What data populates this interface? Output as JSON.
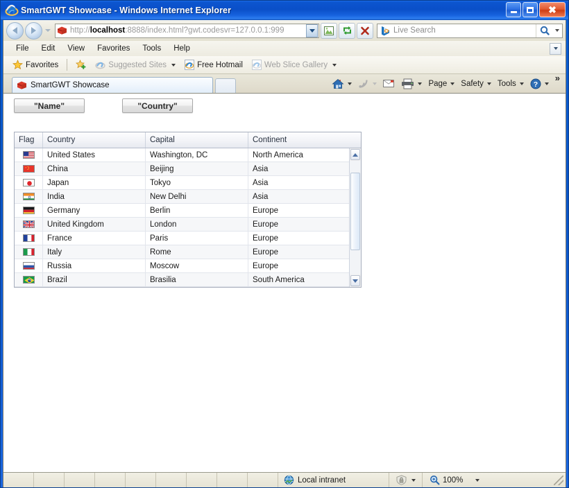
{
  "window": {
    "title": "SmartGWT Showcase - Windows Internet Explorer",
    "icon": "ie-logo-icon",
    "minimize_label": "Minimize",
    "maximize_label": "Maximize",
    "close_label": "Close"
  },
  "nav": {
    "back_label": "Back",
    "forward_label": "Forward",
    "recent_pages_label": "Recent Pages",
    "address_prefix": "http://",
    "address_host": "localhost",
    "address_rest": ":8888/index.html?gwt.codesvr=127.0.0.1:999",
    "address_full": "http://localhost:8888/index.html?gwt.codesvr=127.0.0.1:999",
    "compat_label": "Compatibility View",
    "refresh_label": "Refresh",
    "stop_label": "Stop"
  },
  "search": {
    "placeholder": "Live Search",
    "provider_icon": "bing-logo-icon",
    "go_label": "Search",
    "dropdown_label": "Search Options"
  },
  "menu": {
    "items": [
      {
        "label": "File"
      },
      {
        "label": "Edit"
      },
      {
        "label": "View"
      },
      {
        "label": "Favorites"
      },
      {
        "label": "Tools"
      },
      {
        "label": "Help"
      }
    ]
  },
  "favorites_bar": {
    "favorites_label": "Favorites",
    "add_label": "Add to Favorites Bar",
    "items": [
      {
        "label": "Suggested Sites",
        "dim": true,
        "caret": true
      },
      {
        "label": "Free Hotmail",
        "dim": false,
        "caret": false
      },
      {
        "label": "Web Slice Gallery",
        "dim": true,
        "caret": true
      }
    ]
  },
  "tabs": {
    "active": {
      "label": "SmartGWT Showcase",
      "icon": "page-icon"
    },
    "new_tab_label": "New Tab"
  },
  "command_bar": {
    "home_label": "Home",
    "feeds_label": "Feeds",
    "mail_label": "Read Mail",
    "print_label": "Print",
    "page_label": "Page",
    "safety_label": "Safety",
    "tools_label": "Tools",
    "help_label": "Help",
    "overflow_label": "»"
  },
  "content": {
    "buttons": [
      {
        "label": "\"Name\"",
        "name": "name-button"
      },
      {
        "label": "\"Country\"",
        "name": "country-button"
      }
    ],
    "grid": {
      "columns": [
        {
          "key": "flag",
          "label": "Flag"
        },
        {
          "key": "country",
          "label": "Country"
        },
        {
          "key": "capital",
          "label": "Capital"
        },
        {
          "key": "continent",
          "label": "Continent"
        }
      ],
      "rows": [
        {
          "flag": "us",
          "country": "United States",
          "capital": "Washington, DC",
          "continent": "North America"
        },
        {
          "flag": "cn",
          "country": "China",
          "capital": "Beijing",
          "continent": "Asia"
        },
        {
          "flag": "jp",
          "country": "Japan",
          "capital": "Tokyo",
          "continent": "Asia"
        },
        {
          "flag": "in",
          "country": "India",
          "capital": "New Delhi",
          "continent": "Asia"
        },
        {
          "flag": "de",
          "country": "Germany",
          "capital": "Berlin",
          "continent": "Europe"
        },
        {
          "flag": "gb",
          "country": "United Kingdom",
          "capital": "London",
          "continent": "Europe"
        },
        {
          "flag": "fr",
          "country": "France",
          "capital": "Paris",
          "continent": "Europe"
        },
        {
          "flag": "it",
          "country": "Italy",
          "capital": "Rome",
          "continent": "Europe"
        },
        {
          "flag": "ru",
          "country": "Russia",
          "capital": "Moscow",
          "continent": "Europe"
        },
        {
          "flag": "br",
          "country": "Brazil",
          "capital": "Brasilia",
          "continent": "South America"
        }
      ],
      "scrollbar": {
        "up_label": "Scroll Up",
        "down_label": "Scroll Down"
      }
    }
  },
  "status_bar": {
    "zone": "Local intranet",
    "zone_icon": "globe-icon",
    "security_icon": "protected-mode-icon",
    "zoom": "100%",
    "zoom_icon": "zoom-icon"
  },
  "colors": {
    "title_blue": "#0A55C8",
    "frame_blue": "#0a4fc8",
    "chrome_beige": "#eae8dc",
    "grid_header": "#f3f4f8",
    "row_alt": "#f6f7f9",
    "close_red": "#cc3d14"
  }
}
